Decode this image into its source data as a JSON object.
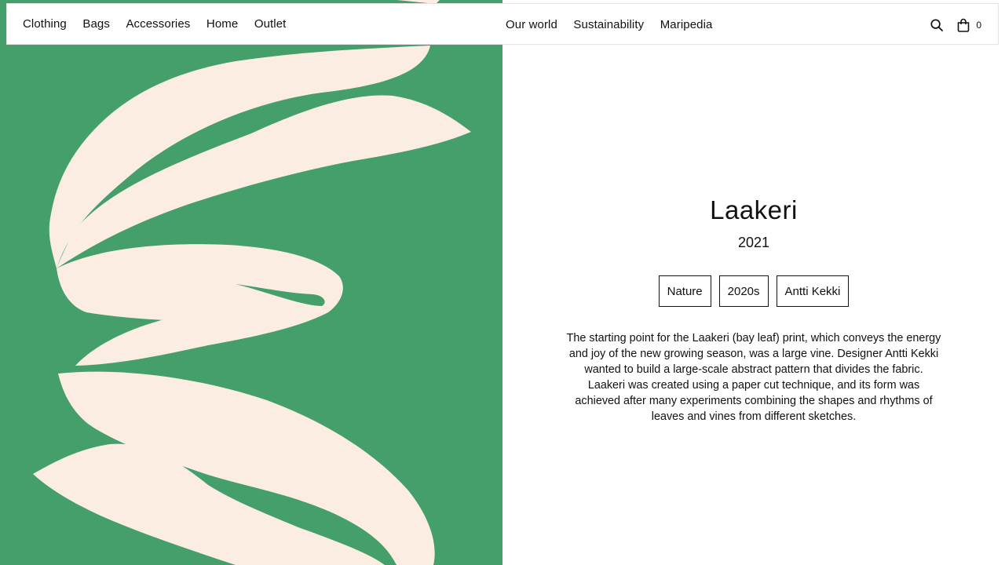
{
  "colors": {
    "art_background": "#449f6b",
    "art_leaf": "#fcede3",
    "text": "#111111",
    "page_background": "#ffffff"
  },
  "nav": {
    "left_items": [
      {
        "label": "Clothing"
      },
      {
        "label": "Bags"
      },
      {
        "label": "Accessories"
      },
      {
        "label": "Home"
      },
      {
        "label": "Outlet"
      }
    ],
    "center_items": [
      {
        "label": "Our world"
      },
      {
        "label": "Sustainability"
      },
      {
        "label": "Maripedia"
      }
    ],
    "search_icon": "search-icon",
    "cart_icon": "shopping-bag-icon",
    "cart_count": "0"
  },
  "print": {
    "title": "Laakeri",
    "year": "2021",
    "tags": [
      {
        "label": "Nature"
      },
      {
        "label": "2020s"
      },
      {
        "label": "Antti Kekki"
      }
    ],
    "description": "The starting point for the Laakeri (bay leaf) print, which conveys the energy and joy of the new growing season, was a large vine. Designer Antti Kekki wanted to build a large-scale abstract pattern that divides the fabric. Laakeri was created using a paper cut technique, and its form was achieved after many experiments combining the shapes and rhythms of leaves and vines from different sketches."
  }
}
